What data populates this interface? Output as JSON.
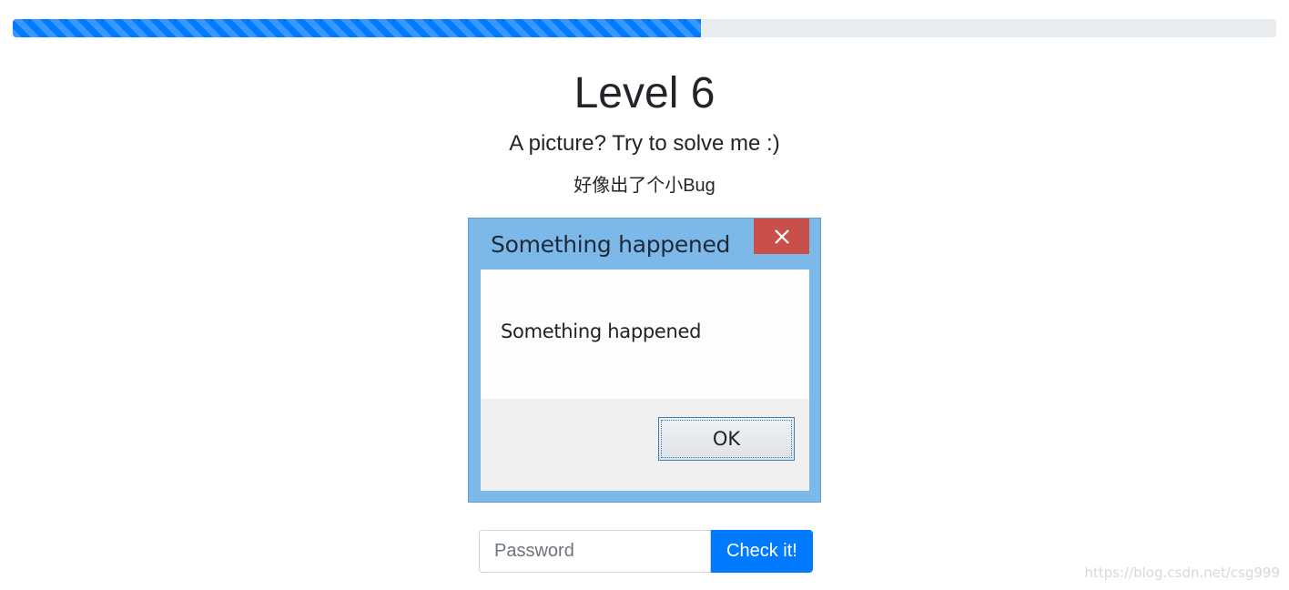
{
  "progress": {
    "value_percent": 54.5,
    "color": "#007bff"
  },
  "header": {
    "title": "Level 6",
    "subtitle": "A picture? Try to solve me :)",
    "note": "好像出了个小Bug"
  },
  "picture": {
    "dialog_title": "Something happened",
    "message": "Something happened",
    "ok_label": "OK",
    "close_icon": "close-icon"
  },
  "form": {
    "password_placeholder": "Password",
    "password_value": "",
    "submit_label": "Check it!"
  },
  "watermark": "https://blog.csdn.net/csg999",
  "colors": {
    "accent": "#007bff",
    "dialog_frame": "#7cb9e8",
    "dialog_close": "#c9504a"
  }
}
